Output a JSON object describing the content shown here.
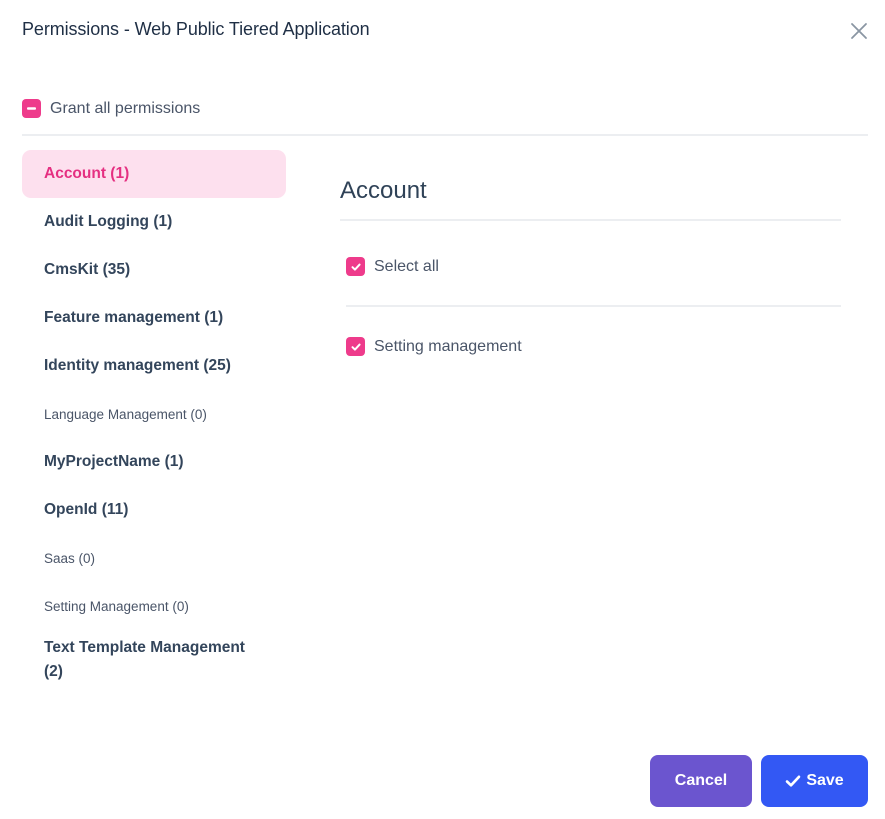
{
  "dialog": {
    "title": "Permissions - Web Public Tiered Application",
    "close_icon": "close-icon"
  },
  "grant_all": {
    "label": "Grant all permissions",
    "state": "indeterminate",
    "accent": "#ee3b8b"
  },
  "sidebar": {
    "items": [
      {
        "label": "Account (1)",
        "active": true,
        "style": "bold"
      },
      {
        "label": "Audit Logging (1)",
        "active": false,
        "style": "bold"
      },
      {
        "label": "CmsKit (35)",
        "active": false,
        "style": "bold"
      },
      {
        "label": "Feature management (1)",
        "active": false,
        "style": "bold"
      },
      {
        "label": "Identity management (25)",
        "active": false,
        "style": "bold"
      },
      {
        "label": "Language Management (0)",
        "active": false,
        "style": "light"
      },
      {
        "label": "MyProjectName (1)",
        "active": false,
        "style": "bold"
      },
      {
        "label": "OpenId (11)",
        "active": false,
        "style": "bold"
      },
      {
        "label": "Saas (0)",
        "active": false,
        "style": "light"
      },
      {
        "label": "Setting Management (0)",
        "active": false,
        "style": "light"
      },
      {
        "label": "Text Template Management (2)",
        "active": false,
        "style": "bold"
      }
    ]
  },
  "main": {
    "title": "Account",
    "select_all": {
      "label": "Select all",
      "checked": true
    },
    "permissions": [
      {
        "label": "Setting management",
        "checked": true
      }
    ]
  },
  "footer": {
    "cancel_label": "Cancel",
    "save_label": "Save",
    "save_icon": "check-icon",
    "colors": {
      "cancel": "#6b55cf",
      "save": "#3358f4"
    }
  }
}
